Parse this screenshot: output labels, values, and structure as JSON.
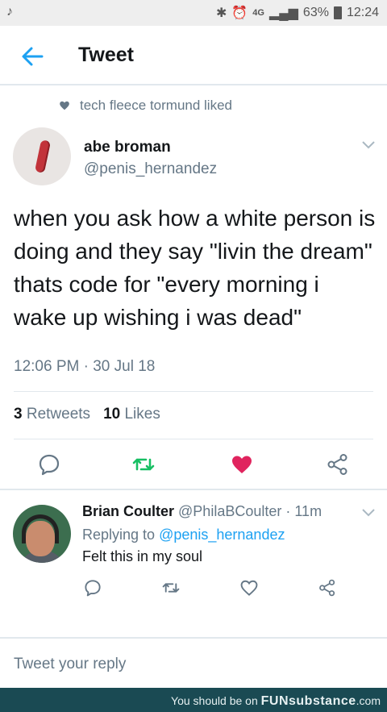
{
  "status_bar": {
    "left_icon": "music-note-icon",
    "network": "4G",
    "battery": "63%",
    "time": "12:24"
  },
  "header": {
    "title": "Tweet",
    "back_icon": "back-arrow-icon",
    "accent": "#1da1f2"
  },
  "social_context": {
    "text": "tech fleece tormund liked",
    "icon": "heart-icon"
  },
  "tweet": {
    "author_name": "abe broman",
    "author_handle": "@penis_hernandez",
    "text": "when you ask how a white person is doing and they say \"livin the dream\" thats code for \"every morning i wake up wishing i was dead\"",
    "timestamp": "12:06 PM · 30 Jul 18",
    "retweets_count": "3",
    "retweets_label": "Retweets",
    "likes_count": "10",
    "likes_label": "Likes",
    "liked": true,
    "like_color": "#e0245e",
    "retweet_color": "#17bf63"
  },
  "reply": {
    "author_name": "Brian Coulter",
    "author_handle": "@PhilaBCoulter",
    "age": "· 11m",
    "replying_to_label": "Replying to",
    "replying_to_handle": "@penis_hernandez",
    "text": "Felt this in my soul"
  },
  "composer": {
    "placeholder": "Tweet your reply"
  },
  "watermark": {
    "prefix": "You should be on",
    "brand": "FUNsubstance",
    "suffix": ".com"
  }
}
